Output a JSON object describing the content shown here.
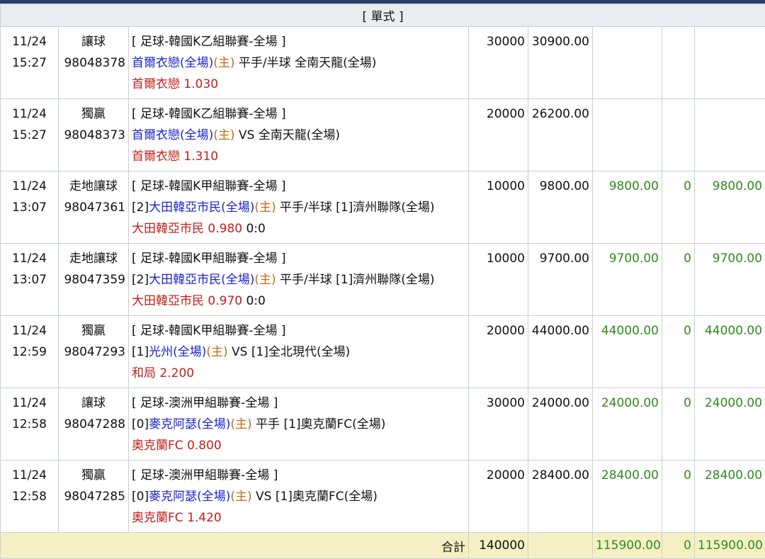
{
  "section_label": "[ 單式 ]",
  "rows": [
    {
      "date": "11/24",
      "time": "15:27",
      "type": "讓球",
      "ticket": "98048378",
      "league": "[ 足球-韓國K乙組聯賽-全場 ]",
      "home_prefix": "",
      "home": "首爾衣戀(全場)",
      "home_mark": "(主)",
      "mid": " 平手/半球 ",
      "away_prefix": "",
      "away": "全南天龍(全場)",
      "selection": "首爾衣戀",
      "odds": "1.030",
      "score": "",
      "stake": "30000",
      "payout": "30900.00",
      "valid": "",
      "commission": "",
      "result": ""
    },
    {
      "date": "11/24",
      "time": "15:27",
      "type": "獨贏",
      "ticket": "98048373",
      "league": "[ 足球-韓國K乙組聯賽-全場 ]",
      "home_prefix": "",
      "home": "首爾衣戀(全場)",
      "home_mark": "(主)",
      "mid": " VS ",
      "away_prefix": "",
      "away": "全南天龍(全場)",
      "selection": "首爾衣戀",
      "odds": "1.310",
      "score": "",
      "stake": "20000",
      "payout": "26200.00",
      "valid": "",
      "commission": "",
      "result": ""
    },
    {
      "date": "11/24",
      "time": "13:07",
      "type": "走地讓球",
      "ticket": "98047361",
      "league": "[ 足球-韓國K甲組聯賽-全場 ]",
      "home_prefix": "[2]",
      "home": "大田韓亞市民(全場)",
      "home_mark": "(主)",
      "mid": " 平手/半球 ",
      "away_prefix": "[1]",
      "away": "濟州聯隊(全場)",
      "selection": "大田韓亞市民",
      "odds": "0.980",
      "score": "0:0",
      "stake": "10000",
      "payout": "9800.00",
      "valid": "9800.00",
      "commission": "0",
      "result": "9800.00"
    },
    {
      "date": "11/24",
      "time": "13:07",
      "type": "走地讓球",
      "ticket": "98047359",
      "league": "[ 足球-韓國K甲組聯賽-全場 ]",
      "home_prefix": "[2]",
      "home": "大田韓亞市民(全場)",
      "home_mark": "(主)",
      "mid": " 平手/半球 ",
      "away_prefix": "[1]",
      "away": "濟州聯隊(全場)",
      "selection": "大田韓亞市民",
      "odds": "0.970",
      "score": "0:0",
      "stake": "10000",
      "payout": "9700.00",
      "valid": "9700.00",
      "commission": "0",
      "result": "9700.00"
    },
    {
      "date": "11/24",
      "time": "12:59",
      "type": "獨贏",
      "ticket": "98047293",
      "league": "[ 足球-韓國K甲組聯賽-全場 ]",
      "home_prefix": "[1]",
      "home": "光州(全場)",
      "home_mark": "(主)",
      "mid": " VS ",
      "away_prefix": "[1]",
      "away": "全北現代(全場)",
      "selection": "和局",
      "odds": "2.200",
      "score": "",
      "stake": "20000",
      "payout": "44000.00",
      "valid": "44000.00",
      "commission": "0",
      "result": "44000.00"
    },
    {
      "date": "11/24",
      "time": "12:58",
      "type": "讓球",
      "ticket": "98047288",
      "league": "[ 足球-澳洲甲組聯賽-全場 ]",
      "home_prefix": "[0]",
      "home": "麥克阿瑟(全場)",
      "home_mark": "(主)",
      "mid": " 平手 ",
      "away_prefix": "[1]",
      "away": "奧克蘭FC(全場)",
      "selection": "奧克蘭FC",
      "odds": "0.800",
      "score": "",
      "stake": "30000",
      "payout": "24000.00",
      "valid": "24000.00",
      "commission": "0",
      "result": "24000.00"
    },
    {
      "date": "11/24",
      "time": "12:58",
      "type": "獨贏",
      "ticket": "98047285",
      "league": "[ 足球-澳洲甲組聯賽-全場 ]",
      "home_prefix": "[0]",
      "home": "麥克阿瑟(全場)",
      "home_mark": "(主)",
      "mid": " VS ",
      "away_prefix": "[1]",
      "away": "奧克蘭FC(全場)",
      "selection": "奧克蘭FC",
      "odds": "1.420",
      "score": "",
      "stake": "20000",
      "payout": "28400.00",
      "valid": "28400.00",
      "commission": "0",
      "result": "28400.00"
    }
  ],
  "total": {
    "label": "合計",
    "stake": "140000",
    "payout": "",
    "valid": "115900.00",
    "commission": "0",
    "result": "115900.00"
  }
}
